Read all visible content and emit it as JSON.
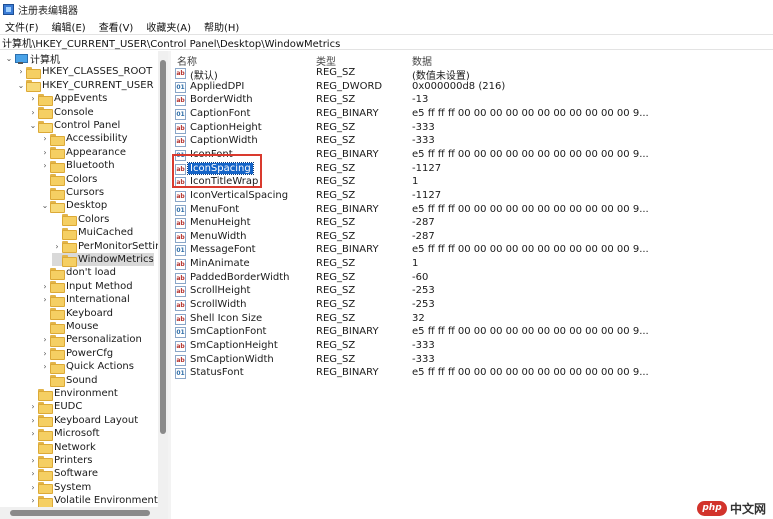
{
  "window": {
    "title": "注册表编辑器"
  },
  "menu": [
    "文件(F)",
    "编辑(E)",
    "查看(V)",
    "收藏夹(A)",
    "帮助(H)"
  ],
  "address": "计算机\\HKEY_CURRENT_USER\\Control Panel\\Desktop\\WindowMetrics",
  "tree": [
    {
      "label": "计算机",
      "expander": "v",
      "icon": "computer-icon",
      "depth": 0
    },
    {
      "label": "HKEY_CLASSES_ROOT",
      "expander": ">",
      "icon": "folder-icon",
      "depth": 1
    },
    {
      "label": "HKEY_CURRENT_USER",
      "expander": "v",
      "icon": "folder-icon",
      "depth": 1
    },
    {
      "label": "AppEvents",
      "expander": ">",
      "icon": "folder-icon",
      "depth": 2
    },
    {
      "label": "Console",
      "expander": ">",
      "icon": "folder-icon",
      "depth": 2
    },
    {
      "label": "Control Panel",
      "expander": "v",
      "icon": "folder-icon",
      "depth": 2
    },
    {
      "label": "Accessibility",
      "expander": ">",
      "icon": "folder-icon",
      "depth": 3
    },
    {
      "label": "Appearance",
      "expander": ">",
      "icon": "folder-icon",
      "depth": 3
    },
    {
      "label": "Bluetooth",
      "expander": ">",
      "icon": "folder-icon",
      "depth": 3
    },
    {
      "label": "Colors",
      "expander": "",
      "icon": "folder-icon",
      "depth": 3
    },
    {
      "label": "Cursors",
      "expander": "",
      "icon": "folder-icon",
      "depth": 3
    },
    {
      "label": "Desktop",
      "expander": "v",
      "icon": "folder-icon",
      "depth": 3
    },
    {
      "label": "Colors",
      "expander": "",
      "icon": "folder-icon",
      "depth": 4
    },
    {
      "label": "MuiCached",
      "expander": "",
      "icon": "folder-icon",
      "depth": 4
    },
    {
      "label": "PerMonitorSettin",
      "expander": ">",
      "icon": "folder-icon",
      "depth": 4
    },
    {
      "label": "WindowMetrics",
      "expander": "",
      "icon": "folder-icon",
      "depth": 4,
      "selected": true
    },
    {
      "label": "don't load",
      "expander": "",
      "icon": "folder-icon",
      "depth": 3
    },
    {
      "label": "Input Method",
      "expander": ">",
      "icon": "folder-icon",
      "depth": 3
    },
    {
      "label": "International",
      "expander": ">",
      "icon": "folder-icon",
      "depth": 3
    },
    {
      "label": "Keyboard",
      "expander": "",
      "icon": "folder-icon",
      "depth": 3
    },
    {
      "label": "Mouse",
      "expander": "",
      "icon": "folder-icon",
      "depth": 3
    },
    {
      "label": "Personalization",
      "expander": ">",
      "icon": "folder-icon",
      "depth": 3
    },
    {
      "label": "PowerCfg",
      "expander": ">",
      "icon": "folder-icon",
      "depth": 3
    },
    {
      "label": "Quick Actions",
      "expander": ">",
      "icon": "folder-icon",
      "depth": 3
    },
    {
      "label": "Sound",
      "expander": "",
      "icon": "folder-icon",
      "depth": 3
    },
    {
      "label": "Environment",
      "expander": "",
      "icon": "folder-icon",
      "depth": 2
    },
    {
      "label": "EUDC",
      "expander": ">",
      "icon": "folder-icon",
      "depth": 2
    },
    {
      "label": "Keyboard Layout",
      "expander": ">",
      "icon": "folder-icon",
      "depth": 2
    },
    {
      "label": "Microsoft",
      "expander": ">",
      "icon": "folder-icon",
      "depth": 2
    },
    {
      "label": "Network",
      "expander": "",
      "icon": "folder-icon",
      "depth": 2
    },
    {
      "label": "Printers",
      "expander": ">",
      "icon": "folder-icon",
      "depth": 2
    },
    {
      "label": "Software",
      "expander": ">",
      "icon": "folder-icon",
      "depth": 2
    },
    {
      "label": "System",
      "expander": ">",
      "icon": "folder-icon",
      "depth": 2
    },
    {
      "label": "Volatile Environment",
      "expander": ">",
      "icon": "folder-icon",
      "depth": 2
    }
  ],
  "columns": {
    "name": "名称",
    "type": "类型",
    "data": "数据"
  },
  "values": [
    {
      "name": "(默认)",
      "type": "REG_SZ",
      "data": "(数值未设置)",
      "kind": "sz"
    },
    {
      "name": "AppliedDPI",
      "type": "REG_DWORD",
      "data": "0x000000d8 (216)",
      "kind": "bin"
    },
    {
      "name": "BorderWidth",
      "type": "REG_SZ",
      "data": "-13",
      "kind": "sz"
    },
    {
      "name": "CaptionFont",
      "type": "REG_BINARY",
      "data": "e5 ff ff ff 00 00 00 00 00 00 00 00 00 00 00 9...",
      "kind": "bin"
    },
    {
      "name": "CaptionHeight",
      "type": "REG_SZ",
      "data": "-333",
      "kind": "sz"
    },
    {
      "name": "CaptionWidth",
      "type": "REG_SZ",
      "data": "-333",
      "kind": "sz"
    },
    {
      "name": "IconFont",
      "type": "REG_BINARY",
      "data": "e5 ff ff ff 00 00 00 00 00 00 00 00 00 00 00 9...",
      "kind": "bin"
    },
    {
      "name": "IconSpacing",
      "type": "REG_SZ",
      "data": "-1127",
      "kind": "sz",
      "selected": true
    },
    {
      "name": "IconTitleWrap",
      "type": "REG_SZ",
      "data": "1",
      "kind": "sz"
    },
    {
      "name": "IconVerticalSpacing",
      "type": "REG_SZ",
      "data": "-1127",
      "kind": "sz"
    },
    {
      "name": "MenuFont",
      "type": "REG_BINARY",
      "data": "e5 ff ff ff 00 00 00 00 00 00 00 00 00 00 00 9...",
      "kind": "bin"
    },
    {
      "name": "MenuHeight",
      "type": "REG_SZ",
      "data": "-287",
      "kind": "sz"
    },
    {
      "name": "MenuWidth",
      "type": "REG_SZ",
      "data": "-287",
      "kind": "sz"
    },
    {
      "name": "MessageFont",
      "type": "REG_BINARY",
      "data": "e5 ff ff ff 00 00 00 00 00 00 00 00 00 00 00 9...",
      "kind": "bin"
    },
    {
      "name": "MinAnimate",
      "type": "REG_SZ",
      "data": "1",
      "kind": "sz"
    },
    {
      "name": "PaddedBorderWidth",
      "type": "REG_SZ",
      "data": "-60",
      "kind": "sz"
    },
    {
      "name": "ScrollHeight",
      "type": "REG_SZ",
      "data": "-253",
      "kind": "sz"
    },
    {
      "name": "ScrollWidth",
      "type": "REG_SZ",
      "data": "-253",
      "kind": "sz"
    },
    {
      "name": "Shell Icon Size",
      "type": "REG_SZ",
      "data": "32",
      "kind": "sz"
    },
    {
      "name": "SmCaptionFont",
      "type": "REG_BINARY",
      "data": "e5 ff ff ff 00 00 00 00 00 00 00 00 00 00 00 9...",
      "kind": "bin"
    },
    {
      "name": "SmCaptionHeight",
      "type": "REG_SZ",
      "data": "-333",
      "kind": "sz"
    },
    {
      "name": "SmCaptionWidth",
      "type": "REG_SZ",
      "data": "-333",
      "kind": "sz"
    },
    {
      "name": "StatusFont",
      "type": "REG_BINARY",
      "data": "e5 ff ff ff 00 00 00 00 00 00 00 00 00 00 00 9...",
      "kind": "bin"
    }
  ],
  "watermark": {
    "logo": "php",
    "text": "中文网"
  },
  "colors": {
    "selection": "#1464c8",
    "highlight_box": "#d93a2e",
    "tree_selected": "#d9d9d9"
  }
}
